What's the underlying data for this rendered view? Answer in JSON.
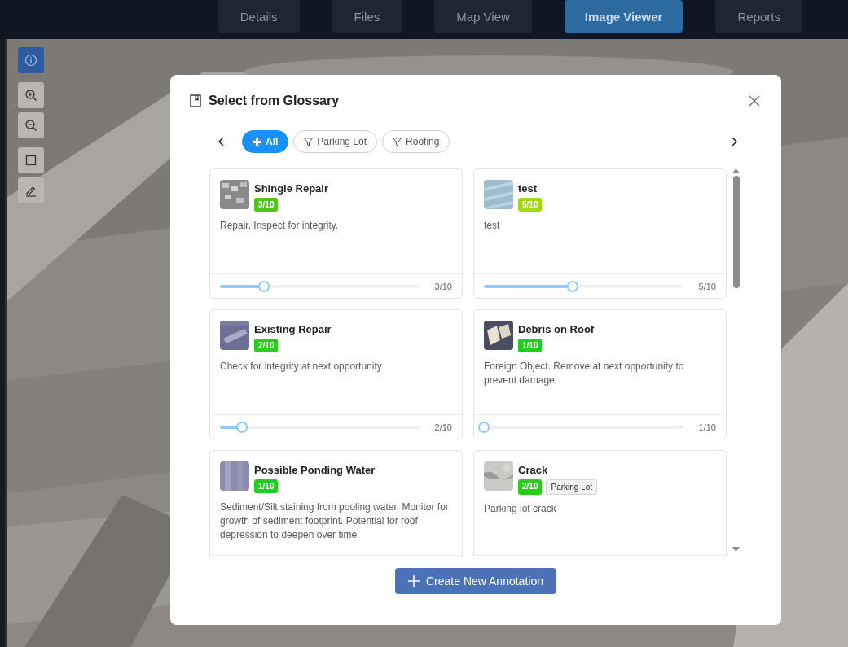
{
  "tabs": [
    {
      "label": "Details",
      "selected": false
    },
    {
      "label": "Files",
      "selected": false
    },
    {
      "label": "Map View",
      "selected": false
    },
    {
      "label": "Image Viewer",
      "selected": true
    },
    {
      "label": "Reports",
      "selected": false
    }
  ],
  "toolbar": [
    {
      "kind": "info",
      "selected": true
    },
    {
      "kind": "zoom-in",
      "selected": false
    },
    {
      "kind": "zoom-out",
      "selected": false
    },
    {
      "kind": "rectangle",
      "selected": false
    },
    {
      "kind": "pencil",
      "selected": false
    }
  ],
  "dialog": {
    "title": "Select from Glossary",
    "filters": [
      {
        "label": "All",
        "kind": "all",
        "selected": true
      },
      {
        "label": "Parking Lot",
        "kind": "filter",
        "selected": false
      },
      {
        "label": "Roofing",
        "kind": "filter",
        "selected": false
      }
    ],
    "items": [
      {
        "title": "Shingle Repair",
        "severity": "3/10",
        "color": "#52c41a",
        "description": "Repair. Inspect for integrity.",
        "level": 0.222,
        "reading": "3/10"
      },
      {
        "title": "test",
        "severity": "5/10",
        "color": "#a0d911",
        "description": "test",
        "level": 0.444,
        "reading": "5/10"
      },
      {
        "title": "Existing Repair",
        "severity": "2/10",
        "color": "#2ccc1e",
        "description": "Check for integrity at next opportunity",
        "level": 0.111,
        "reading": "2/10"
      },
      {
        "title": "Debris on Roof",
        "severity": "1/10",
        "color": "#1fce1f",
        "description": "Foreign Object. Remove at next opportunity to prevent damage.",
        "level": 0,
        "reading": "1/10"
      },
      {
        "title": "Possible Ponding Water",
        "severity": "1/10",
        "color": "#1fce1f",
        "description": "Sediment/Silt staining from pooling water. Monitor for growth of sediment footprint. Potential for roof depression to deepen over time."
      },
      {
        "title": "Crack",
        "severity": "2/10",
        "color": "#2ccc1e",
        "tags": [
          "Parking Lot"
        ],
        "description": "Parking lot crack"
      }
    ],
    "create_button": "Create New Annotation"
  }
}
